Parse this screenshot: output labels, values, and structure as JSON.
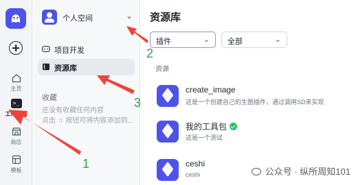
{
  "rail": {
    "items": [
      {
        "label": "主页",
        "icon": "home-icon"
      },
      {
        "label": "工作空间",
        "icon": "terminal-icon",
        "glyph": ">_"
      },
      {
        "label": "商店",
        "icon": "store-icon"
      },
      {
        "label": "模板",
        "icon": "template-icon"
      }
    ]
  },
  "sidebar": {
    "space_name": "个人空间",
    "nav": [
      {
        "label": "项目开发",
        "icon": "gamepad-icon"
      },
      {
        "label": "资源库",
        "icon": "book-icon"
      }
    ],
    "favorites_title": "收藏",
    "favorites_empty": "还没有收藏任何内容\n点击 ☆ 按钮可将内容添加到..."
  },
  "main": {
    "title": "资源库",
    "type_filter": "插件",
    "scope_filter": "全部",
    "section_label": "资源",
    "resources": [
      {
        "name": "create_image",
        "desc": "这是一个创建自己的生图插件，通过调用SD来实现"
      },
      {
        "name": "我的工具包",
        "desc": "这是一个测试",
        "verified": true
      },
      {
        "name": "ceshi",
        "desc": "ceshi"
      }
    ]
  },
  "watermark": "公众号 · 纵所周知101",
  "annotations": {
    "colors": {
      "arrow": "#f04438",
      "number": "#22a84a"
    },
    "numbers": [
      "1",
      "2",
      "3"
    ]
  }
}
